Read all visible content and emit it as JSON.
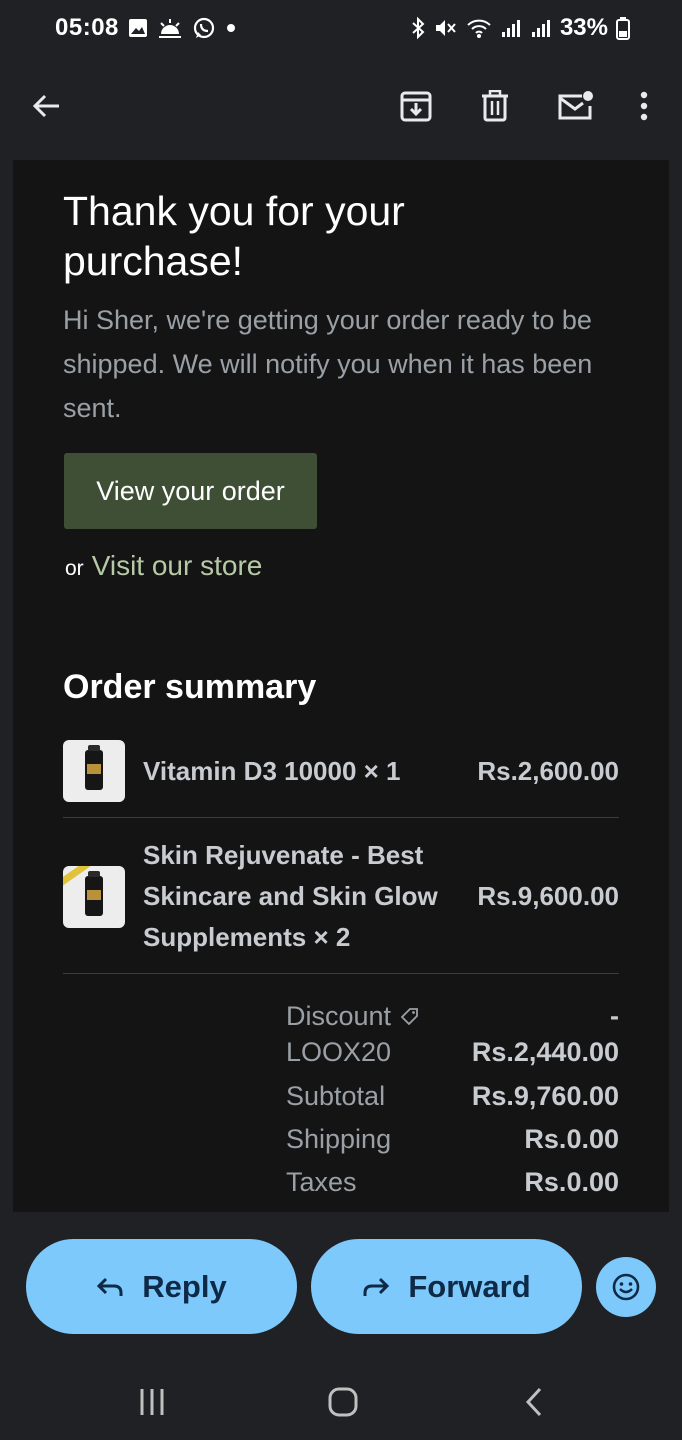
{
  "status_bar": {
    "time": "05:08",
    "battery": "33%",
    "left_icons": [
      "gallery-icon",
      "weather-icon",
      "whatsapp-icon",
      "dot-icon"
    ],
    "right_icons": [
      "bluetooth-icon",
      "mute-icon",
      "wifi-icon",
      "signal-icon",
      "signal-icon",
      "battery-icon"
    ]
  },
  "app_bar": {
    "icons": [
      "back-arrow-icon",
      "archive-icon",
      "delete-icon",
      "mark-unread-icon",
      "more-vert-icon"
    ]
  },
  "email": {
    "title": "Thank you for your purchase!",
    "intro": "Hi Sher, we're getting your order ready to be shipped. We will notify you when it has been sent.",
    "view_order_label": "View your order",
    "or_text": "or",
    "store_link_label": "Visit our store",
    "summary_heading": "Order summary",
    "items": [
      {
        "name": "Vitamin D3 10000 × 1",
        "price": "Rs.2,600.00"
      },
      {
        "name": "Skin Rejuvenate - Best Skincare and Skin Glow Supplements × 2",
        "price": "Rs.9,600.00"
      }
    ],
    "totals": {
      "discount_label": "Discount",
      "discount_code": "LOOX20",
      "discount_sign": "-",
      "discount_value": "Rs.2,440.00",
      "subtotal_label": "Subtotal",
      "subtotal_value": "Rs.9,760.00",
      "shipping_label": "Shipping",
      "shipping_value": "Rs.0.00",
      "taxes_label": "Taxes",
      "taxes_value": "Rs.0.00"
    }
  },
  "actions": {
    "reply_label": "Reply",
    "forward_label": "Forward",
    "emoji_icon": "emoji-icon"
  },
  "nav_bar": {
    "icons": [
      "recents-icon",
      "home-icon",
      "back-icon"
    ]
  },
  "colors": {
    "accent": "#7dc9fb",
    "button_green": "#3f4f36",
    "link_green": "#b6c9a6",
    "background": "#202124",
    "email_bg": "#141414"
  }
}
